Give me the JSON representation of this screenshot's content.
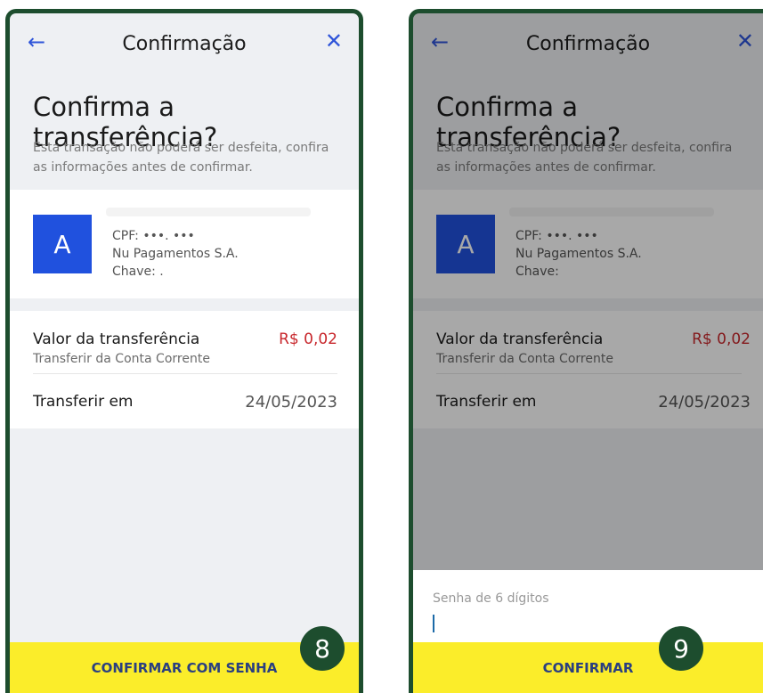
{
  "colors": {
    "frame": "#1d4d2e",
    "accent": "#2051de",
    "cta": "#fbed2a",
    "amount": "#c8282d"
  },
  "left": {
    "header": {
      "title": "Confirmação",
      "back_icon": "←",
      "close_icon": "✕"
    },
    "heading": "Confirma a transferência?",
    "subtitle": "Esta transação não poderá ser desfeita, confira as informações antes de confirmar.",
    "recipient": {
      "initial": "A",
      "cpf": "CPF: •••.         •••",
      "bank": "Nu Pagamentos S.A.",
      "key": "Chave: ."
    },
    "transfer": {
      "label": "Valor da transferência",
      "amount": "R$ 0,02",
      "source": "Transferir da Conta Corrente"
    },
    "date_row": {
      "label": "Transferir em",
      "value": "24/05/2023"
    },
    "cta": "CONFIRMAR COM SENHA",
    "step": "8"
  },
  "right": {
    "header": {
      "title": "Confirmação",
      "back_icon": "←",
      "close_icon": "✕"
    },
    "heading": "Confirma a transferência?",
    "subtitle": "Esta transação não poderá ser desfeita, confira as informações antes de confirmar.",
    "recipient": {
      "initial": "A",
      "cpf": "CPF: •••.         •••",
      "bank": "Nu Pagamentos S.A.",
      "key": "Chave:"
    },
    "transfer": {
      "label": "Valor da transferência",
      "amount": "R$ 0,02",
      "source": "Transferir da Conta Corrente"
    },
    "date_row": {
      "label": "Transferir em",
      "value": "24/05/2023"
    },
    "password_placeholder": "Senha de 6 dígitos",
    "cta": "CONFIRMAR",
    "step": "9"
  }
}
